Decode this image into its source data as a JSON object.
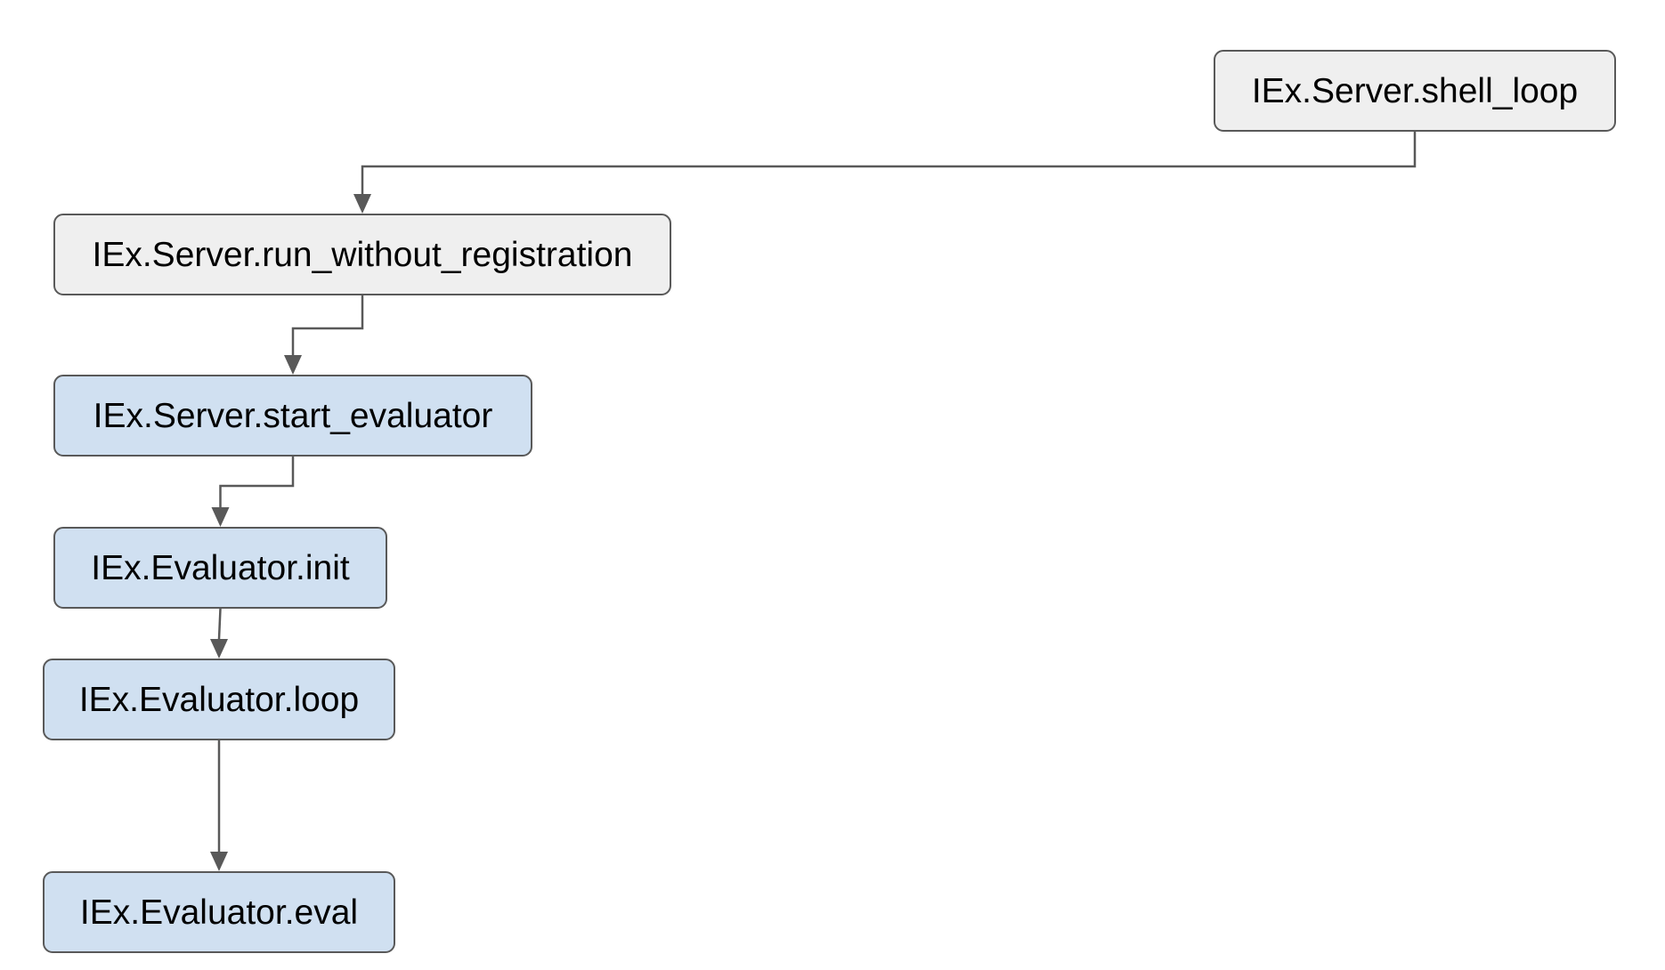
{
  "diagram": {
    "colors": {
      "background": "#ffffff",
      "gray_fill": "#efefef",
      "blue_fill": "#d0e0f1",
      "stroke": "#595959",
      "text": "#000000"
    },
    "nodes": [
      {
        "id": "shell_loop",
        "label": "IEx.Server.shell_loop",
        "fill": "gray"
      },
      {
        "id": "run_without_registration",
        "label": "IEx.Server.run_without_registration",
        "fill": "gray"
      },
      {
        "id": "start_evaluator",
        "label": "IEx.Server.start_evaluator",
        "fill": "blue"
      },
      {
        "id": "evaluator_init",
        "label": "IEx.Evaluator.init",
        "fill": "blue"
      },
      {
        "id": "evaluator_loop",
        "label": "IEx.Evaluator.loop",
        "fill": "blue"
      },
      {
        "id": "evaluator_eval",
        "label": "IEx.Evaluator.eval",
        "fill": "blue"
      }
    ],
    "edges": [
      {
        "from": "shell_loop",
        "to": "run_without_registration"
      },
      {
        "from": "run_without_registration",
        "to": "start_evaluator"
      },
      {
        "from": "start_evaluator",
        "to": "evaluator_init"
      },
      {
        "from": "evaluator_init",
        "to": "evaluator_loop"
      },
      {
        "from": "evaluator_loop",
        "to": "evaluator_eval"
      }
    ]
  }
}
